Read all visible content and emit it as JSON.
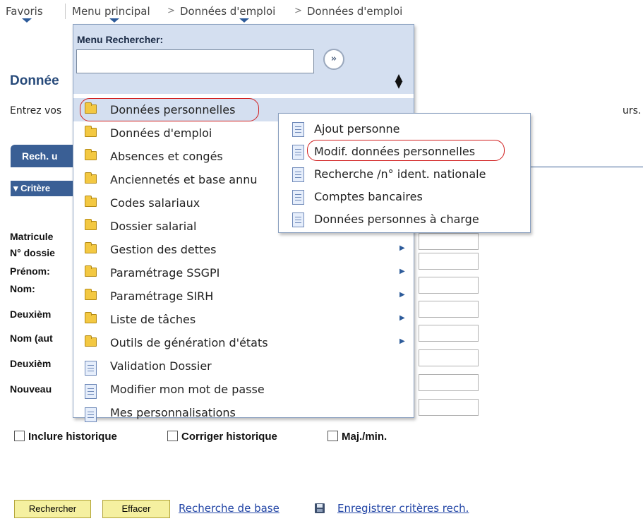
{
  "nav": {
    "favorites": "Favoris",
    "main_menu": "Menu principal",
    "crumb1": "Données d'emploi",
    "crumb2": "Données d'emploi"
  },
  "page": {
    "title": "Donnée",
    "intro": "Entrez vos",
    "intro_end": "urs.",
    "tab": "Rech. u",
    "criteria": "▾ Critère",
    "fields": [
      "Matricule",
      "N° dossie",
      "Prénom:",
      "Nom:",
      "Deuxièm",
      "Nom (aut",
      "Deuxièm",
      "Nouveau"
    ],
    "checkboxes": [
      "Inclure historique",
      "Corriger historique",
      "Maj./min."
    ],
    "buttons": {
      "search": "Rechercher",
      "clear": "Effacer"
    },
    "links": {
      "basic_search": "Recherche de base",
      "save_criteria": "Enregistrer critères rech."
    }
  },
  "menu": {
    "search_label": "Menu Rechercher:",
    "search_value": "",
    "go_symbol": "»",
    "items": [
      {
        "label": "Données personnelles",
        "icon": "folder-icon",
        "arrow": false
      },
      {
        "label": "Données d'emploi",
        "icon": "folder-icon",
        "arrow": false
      },
      {
        "label": "Absences et congés",
        "icon": "folder-icon",
        "arrow": false
      },
      {
        "label": "Anciennetés et base annu",
        "icon": "folder-icon",
        "arrow": false
      },
      {
        "label": "Codes salariaux",
        "icon": "folder-icon",
        "arrow": false
      },
      {
        "label": "Dossier salarial",
        "icon": "folder-icon",
        "arrow": false
      },
      {
        "label": "Gestion des dettes",
        "icon": "folder-icon",
        "arrow": true
      },
      {
        "label": "Paramétrage SSGPI",
        "icon": "folder-icon",
        "arrow": true
      },
      {
        "label": "Paramétrage SIRH",
        "icon": "folder-icon",
        "arrow": true
      },
      {
        "label": "Liste de tâches",
        "icon": "folder-icon",
        "arrow": true
      },
      {
        "label": "Outils de génération d'états",
        "icon": "folder-icon",
        "arrow": true
      },
      {
        "label": "Validation Dossier",
        "icon": "document-icon",
        "arrow": false
      },
      {
        "label": "Modifier mon mot de passe",
        "icon": "document-icon",
        "arrow": false
      },
      {
        "label": "Mes personnalisations",
        "icon": "document-icon",
        "arrow": false
      }
    ]
  },
  "submenu": {
    "items": [
      {
        "label": "Ajout personne",
        "icon": "document-icon"
      },
      {
        "label": "Modif. données personnelles",
        "icon": "document-icon"
      },
      {
        "label": "Recherche /n° ident. nationale",
        "icon": "document-icon"
      },
      {
        "label": "Comptes bancaires",
        "icon": "document-icon"
      },
      {
        "label": "Données personnes à charge",
        "icon": "document-icon"
      }
    ]
  },
  "colors": {
    "accent": "#3a5f95",
    "menu_header": "#d4dff0",
    "highlight_ring": "#d11f1f",
    "button_bg": "#f5f0a0",
    "link": "#2346a6"
  }
}
